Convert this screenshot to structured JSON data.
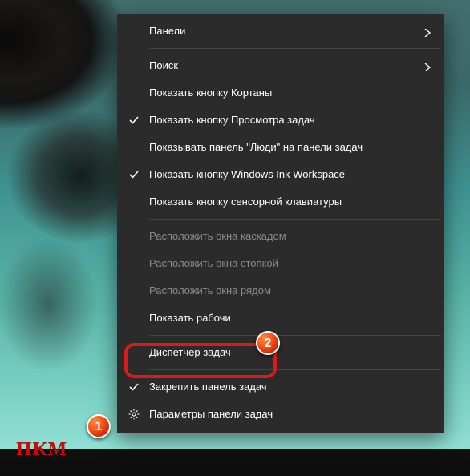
{
  "menu": {
    "panels": "Панели",
    "search": "Поиск",
    "show_cortana_button": "Показать кнопку Кортаны",
    "show_taskview_button": "Показать кнопку Просмотра задач",
    "show_people_bar": "Показывать панель \"Люди\" на панели задач",
    "show_ink_workspace": "Показать кнопку Windows Ink Workspace",
    "show_touch_keyboard": "Показать кнопку сенсорной клавиатуры",
    "cascade_windows": "Расположить окна каскадом",
    "stack_windows": "Расположить окна стопкой",
    "side_by_side_windows": "Расположить окна рядом",
    "show_desktop_truncated": "Показать рабочи",
    "task_manager": "Диспетчер задач",
    "lock_taskbar": "Закрепить панель задач",
    "taskbar_settings": "Параметры панели задач"
  },
  "annotations": {
    "badge1": "1",
    "badge2": "2",
    "pkm": "ПКМ"
  }
}
